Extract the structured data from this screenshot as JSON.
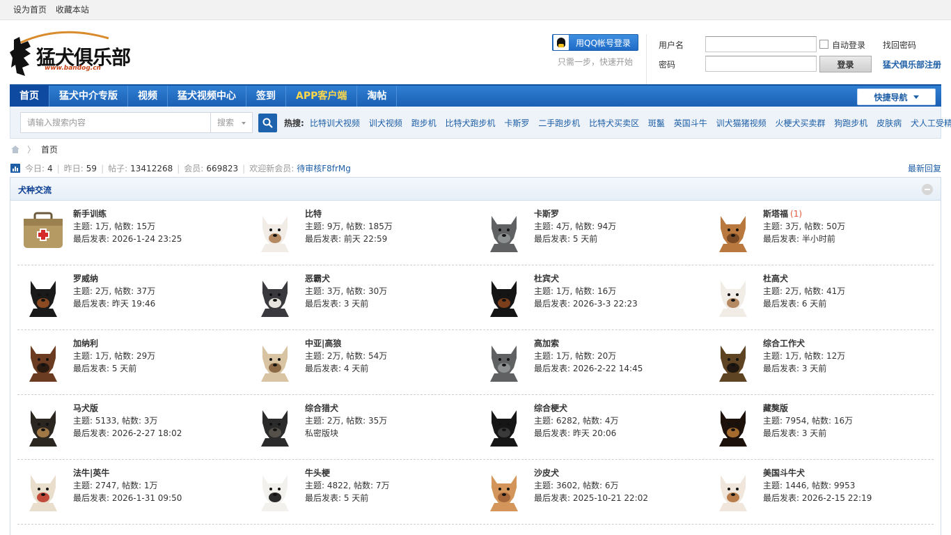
{
  "topbar": {
    "set_home": "设为首页",
    "bookmark": "收藏本站"
  },
  "logo": {
    "text": "猛犬俱乐部",
    "url": "www.bandog.cn"
  },
  "header": {
    "qq_login": "用QQ帐号登录",
    "qq_tip": "只需一步，快速开始",
    "username_label": "用户名",
    "password_label": "密码",
    "auto_login": "自动登录",
    "login_button": "登录",
    "find_password": "找回密码",
    "register": "猛犬俱乐部注册"
  },
  "nav": {
    "items": [
      "首页",
      "猛犬中介专版",
      "视频",
      "猛犬视频中心",
      "签到",
      "APP客户端",
      "淘帖"
    ],
    "quick_nav": "快捷导航"
  },
  "search": {
    "placeholder": "请输入搜索内容",
    "type": "搜索",
    "hot_label": "热搜:",
    "hot_links": [
      "比特训犬视频",
      "训犬视频",
      "跑步机",
      "比特犬跑步机",
      "卡斯罗",
      "二手跑步机",
      "比特犬买卖区",
      "斑鬣",
      "英国斗牛",
      "训犬猫猪视频",
      "火梗犬买卖群",
      "狗跑步机",
      "皮肤病",
      "犬人工受精"
    ]
  },
  "breadcrumb": {
    "home": "首页"
  },
  "stats": {
    "today_label": "今日:",
    "today": "4",
    "yesterday_label": "昨日:",
    "yesterday": "59",
    "posts_label": "帖子:",
    "posts": "13412268",
    "members_label": "会员:",
    "members": "669823",
    "welcome_label": "欢迎新会员:",
    "newest_member": "待审核F8frMg",
    "latest_replies": "最新回复"
  },
  "section": {
    "title": "犬种交流"
  },
  "forums": [
    [
      {
        "name": "新手训练",
        "new": "",
        "counts": "主题: 1万, 帖数: 15万",
        "last": "最后发表: 2026-1-24 23:25",
        "pic": "briefcase"
      },
      {
        "name": "比特",
        "new": "",
        "counts": "主题: 9万, 帖数: 185万",
        "last": "最后发表: 前天 22:59",
        "pic": "dog-white"
      },
      {
        "name": "卡斯罗",
        "new": "",
        "counts": "主题: 4万, 帖数: 94万",
        "last": "最后发表: 5 天前",
        "pic": "dog-grey"
      },
      {
        "name": "斯塔福",
        "new": "(1)",
        "counts": "主题: 3万, 帖数: 50万",
        "last": "最后发表: 半小时前",
        "pic": "dog-tan"
      }
    ],
    [
      {
        "name": "罗威纳",
        "new": "",
        "counts": "主题: 2万, 帖数: 37万",
        "last": "最后发表: 昨天 19:46",
        "pic": "dog-black-tan"
      },
      {
        "name": "恶霸犬",
        "new": "",
        "counts": "主题: 3万, 帖数: 30万",
        "last": "最后发表: 3 天前",
        "pic": "dog-bully"
      },
      {
        "name": "杜宾犬",
        "new": "",
        "counts": "主题: 1万, 帖数: 16万",
        "last": "最后发表: 2026-3-3 22:23",
        "pic": "dog-dobermann"
      },
      {
        "name": "杜高犬",
        "new": "",
        "counts": "主题: 2万, 帖数: 41万",
        "last": "最后发表: 6 天前",
        "pic": "dog-white"
      }
    ],
    [
      {
        "name": "加纳利",
        "new": "",
        "counts": "主题: 1万, 帖数: 29万",
        "last": "最后发表: 5 天前",
        "pic": "dog-brown"
      },
      {
        "name": "中亚|高狼",
        "new": "",
        "counts": "主题: 2万, 帖数: 54万",
        "last": "最后发表: 4 天前",
        "pic": "dog-cream"
      },
      {
        "name": "高加索",
        "new": "",
        "counts": "主题: 1万, 帖数: 20万",
        "last": "最后发表: 2026-2-22 14:45",
        "pic": "dog-grey"
      },
      {
        "name": "综合工作犬",
        "new": "",
        "counts": "主题: 1万, 帖数: 12万",
        "last": "最后发表: 3 天前",
        "pic": "dog-shepherd"
      }
    ],
    [
      {
        "name": "马犬版",
        "new": "",
        "counts": "主题: 5133, 帖数: 3万",
        "last": "最后发表: 2026-2-27 18:02",
        "pic": "dog-malinois"
      },
      {
        "name": "综合猎犬",
        "new": "",
        "counts": "主题: 2万, 帖数: 35万",
        "last": "私密版块",
        "pic": "dog-dark"
      },
      {
        "name": "综合梗犬",
        "new": "",
        "counts": "主题: 6282, 帖数: 4万",
        "last": "最后发表: 昨天 20:06",
        "pic": "dog-black"
      },
      {
        "name": "藏獒版",
        "new": "",
        "counts": "主题: 7954, 帖数: 16万",
        "last": "最后发表: 3 天前",
        "pic": "dog-mastiff"
      }
    ],
    [
      {
        "name": "法牛|英牛",
        "new": "",
        "counts": "主题: 2747, 帖数: 1万",
        "last": "最后发表: 2026-1-31 09:50",
        "pic": "dog-frenchie"
      },
      {
        "name": "牛头梗",
        "new": "",
        "counts": "主题: 4822, 帖数: 7万",
        "last": "最后发表: 5 天前",
        "pic": "dog-bullterrier"
      },
      {
        "name": "沙皮犬",
        "new": "",
        "counts": "主题: 3602, 帖数: 6万",
        "last": "最后发表: 2025-10-21 22:02",
        "pic": "dog-sharpei"
      },
      {
        "name": "美国斗牛犬",
        "new": "",
        "counts": "主题: 1446, 帖数: 9953",
        "last": "最后发表: 2026-2-15 22:19",
        "pic": "dog-bulldog"
      }
    ]
  ],
  "colors": {
    "nav_blue": "#1b5fb3",
    "link_blue": "#1d5ea6",
    "title_blue": "#0a3d91",
    "new_count": "#e0573a"
  }
}
